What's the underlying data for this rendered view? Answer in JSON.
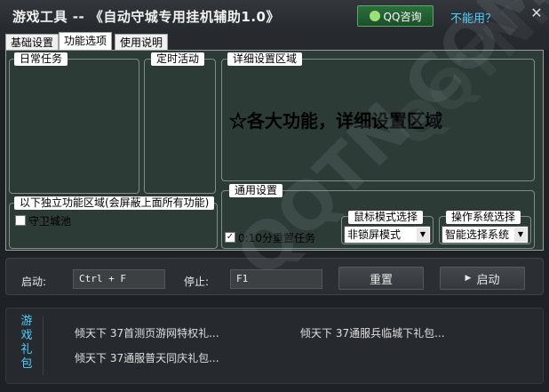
{
  "window": {
    "title": "游戏工具 -- 《自动守城专用挂机辅助1.0》",
    "qq_button": "QQ咨询",
    "help_link": "不能用？",
    "close": "✕"
  },
  "tabs": [
    {
      "label": "基础设置",
      "active": false
    },
    {
      "label": "功能选项",
      "active": true
    },
    {
      "label": "使用说明",
      "active": false
    }
  ],
  "panels": {
    "daily_tasks": "日常任务",
    "timed_events": "定时活动",
    "detail_area": "详细设置区域",
    "detail_text": "☆各大功能，详细设置区域",
    "independent": "以下独立功能区域(会屏蔽上面所有功能)",
    "defend_city": {
      "label": "守卫城池",
      "checked": false
    },
    "general": "通用设置",
    "reset_task": {
      "label": "0:10分重置任务",
      "checked": true
    },
    "mouse_mode": {
      "label": "鼠标模式选择",
      "value": "非锁屏模式"
    },
    "os_select": {
      "label": "操作系统选择",
      "value": "智能选择系统"
    }
  },
  "hotkeys": {
    "start_label": "启动:",
    "start_value": "Ctrl + F",
    "stop_label": "停止:",
    "stop_value": "F1",
    "reset_button": "重置",
    "start_button": "启动"
  },
  "gifts": {
    "label": "游戏礼包",
    "items": [
      "倾天下 37首测页游网特权礼...",
      "倾天下 37通服兵临城下礼包...",
      "倾天下 37通服普天同庆礼包..."
    ]
  },
  "watermark": "QQTN.COM",
  "colors": {
    "panel": "#2c3b35",
    "accent_link": "#4fd0ff",
    "qq_green": "#2b6f3c",
    "background": "#1e2125"
  }
}
